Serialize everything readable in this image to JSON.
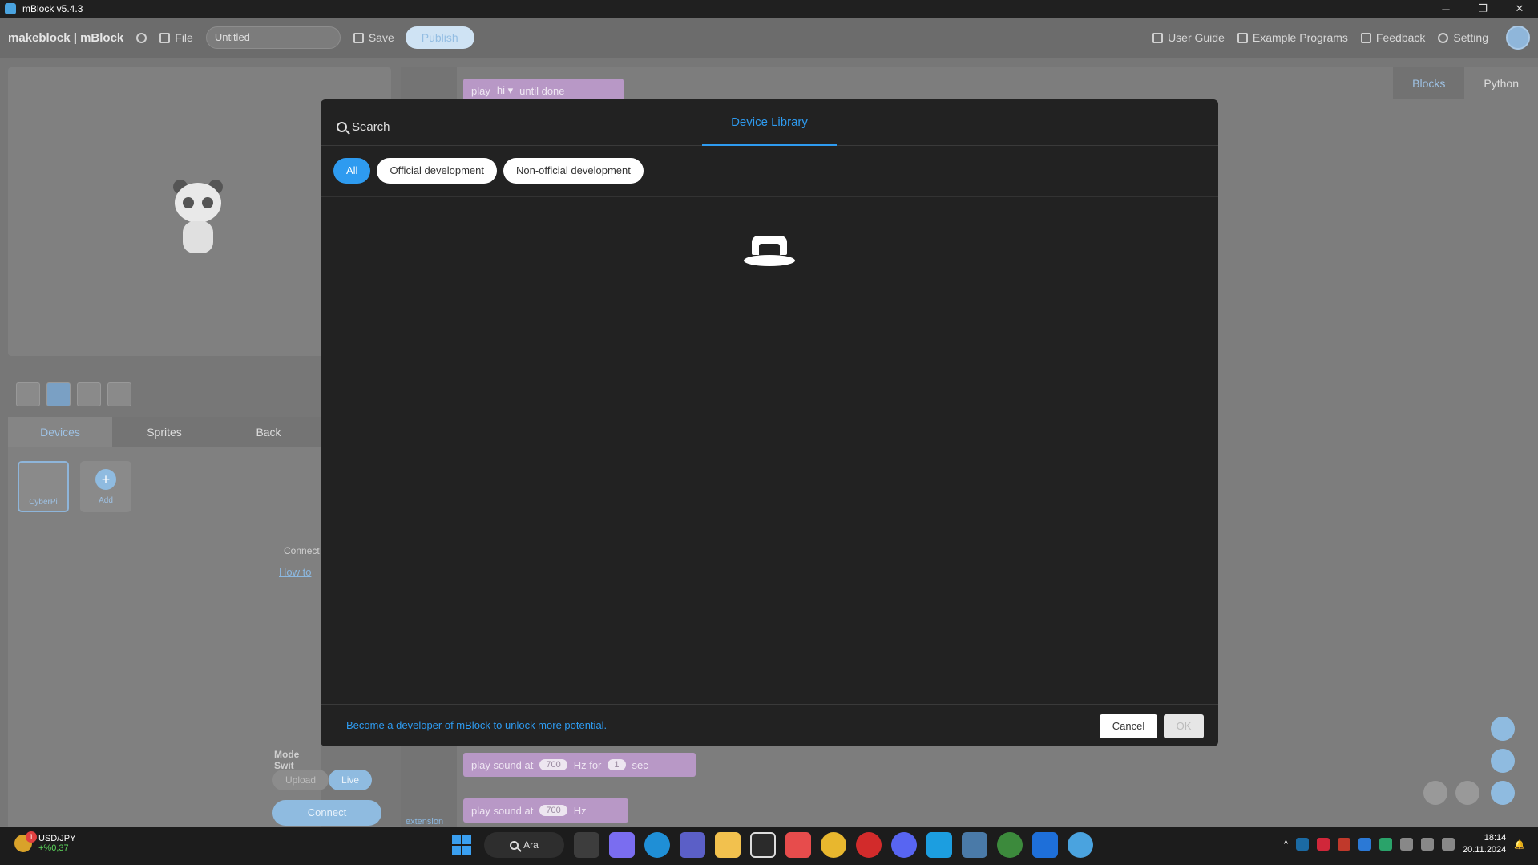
{
  "window": {
    "title": "mBlock v5.4.3",
    "controls": [
      "─",
      "❐",
      "✕"
    ]
  },
  "menubar": {
    "logo": "makeblock | mBlock",
    "file": "File",
    "project_title": "Untitled",
    "save": "Save",
    "publish": "Publish",
    "user_guide": "User Guide",
    "example_programs": "Example Programs",
    "feedback": "Feedback",
    "setting": "Setting"
  },
  "left_panel": {
    "tabs": [
      "Devices",
      "Sprites",
      "Back"
    ],
    "device_card": "CyberPi",
    "add_card": "Add",
    "connect_text": "Connect",
    "how_to": "How to",
    "mode_switch": "Mode Swit",
    "mode_upload": "Upload",
    "mode_live": "Live",
    "connect_button": "Connect"
  },
  "blocks": {
    "tabs": [
      "Blocks",
      "Python"
    ],
    "block1": {
      "a": "play",
      "b": "hi ▾",
      "c": "until done"
    },
    "block2": {
      "a": "play sound at",
      "freq": "700",
      "b": "Hz for",
      "dur": "1",
      "c": "sec"
    },
    "block3": {
      "a": "play sound at",
      "freq": "700",
      "b": "Hz"
    },
    "extension": "extension"
  },
  "modal": {
    "search_label": "Search",
    "tab_title": "Device Library",
    "filters": [
      "All",
      "Official development",
      "Non-official development"
    ],
    "developer_link": "Become a developer of mBlock to unlock more potential.",
    "cancel": "Cancel",
    "ok": "OK"
  },
  "taskbar": {
    "ticker_symbol": "USD/JPY",
    "ticker_change": "+%0,37",
    "ticker_badge": "1",
    "search": "Ara",
    "time": "18:14",
    "date": "20.11.2024"
  }
}
